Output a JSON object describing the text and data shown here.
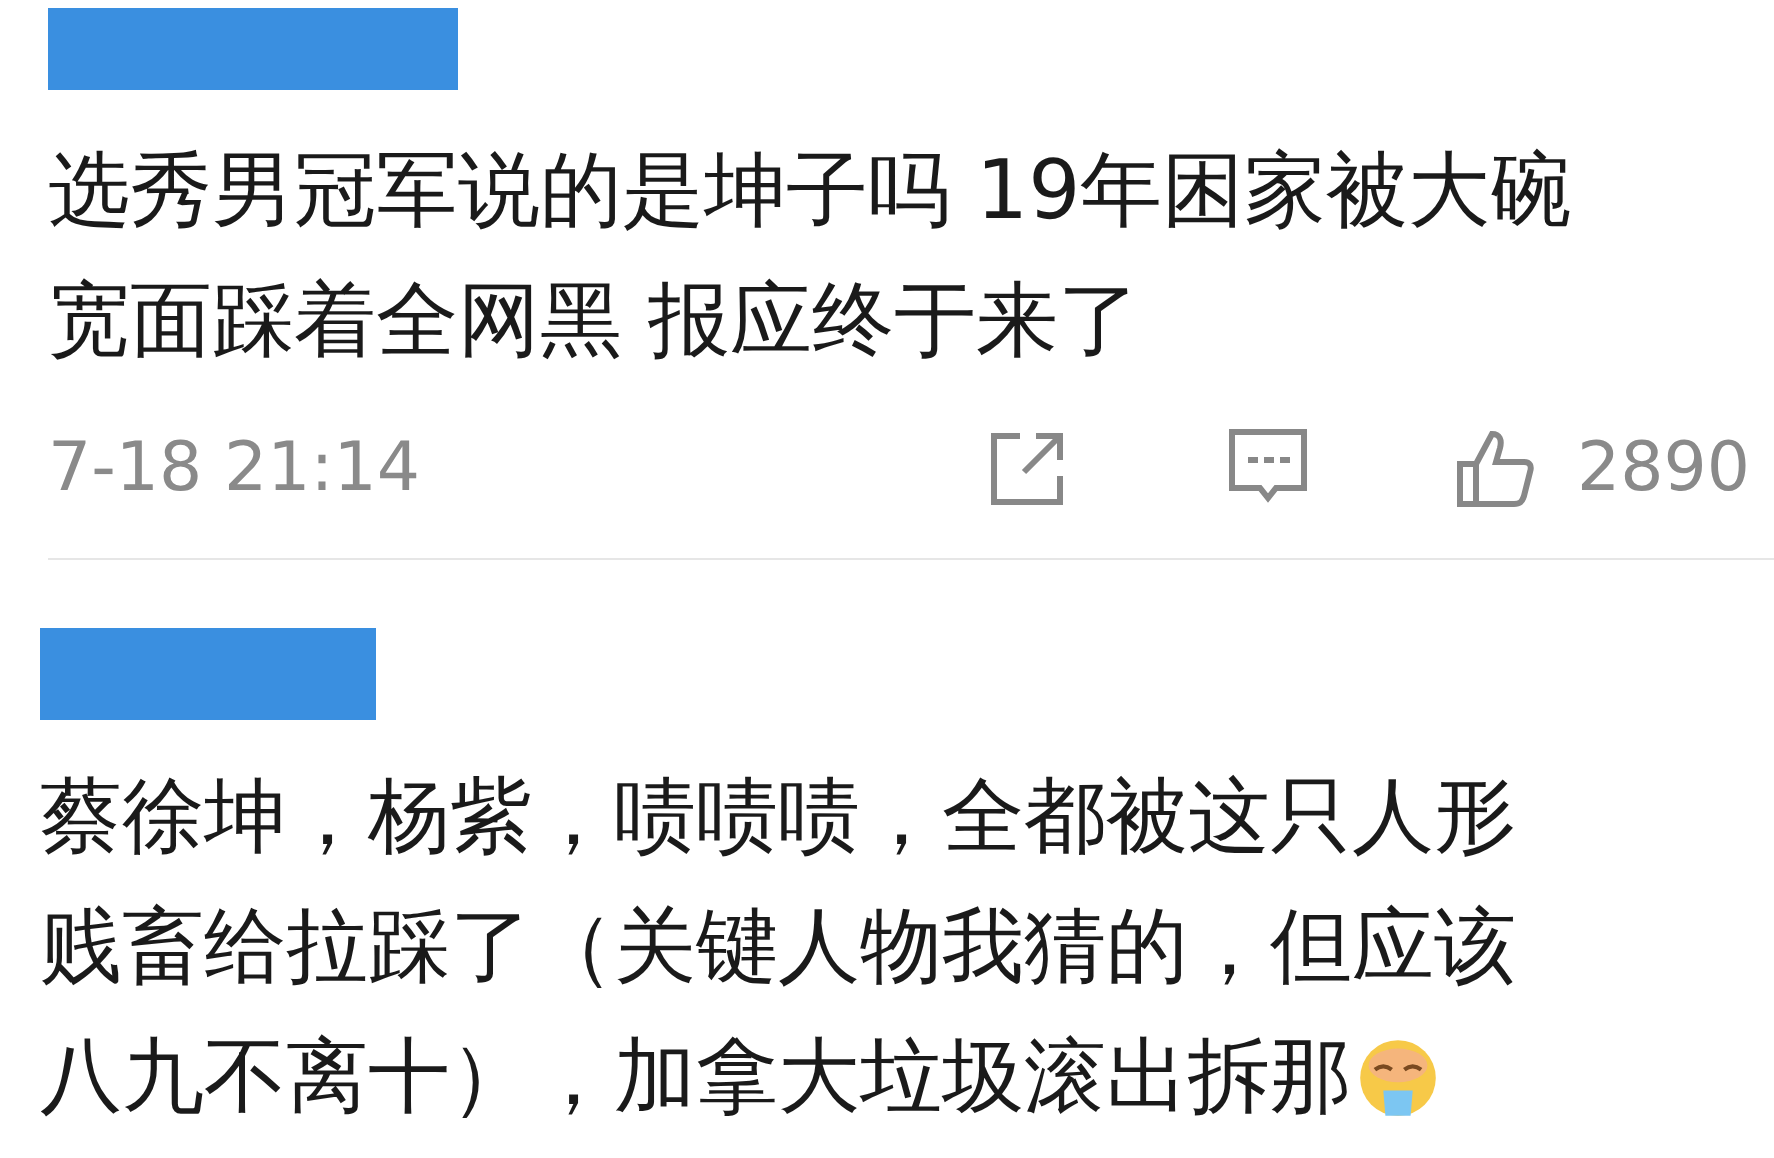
{
  "comments": [
    {
      "lines": [
        "选秀男冠军说的是坤子吗 19年困家被大碗",
        "宽面踩着全网黑 报应终于来了"
      ],
      "time": "7-18 21:14",
      "likes": "2890",
      "emoji": false
    },
    {
      "lines": [
        "蔡徐坤，杨紫，啧啧啧，全都被这只人形",
        "贱畜给拉踩了（关键人物我猜的，但应该",
        "八九不离十），加拿大垃圾滚出拆那"
      ],
      "emoji": true
    }
  ]
}
